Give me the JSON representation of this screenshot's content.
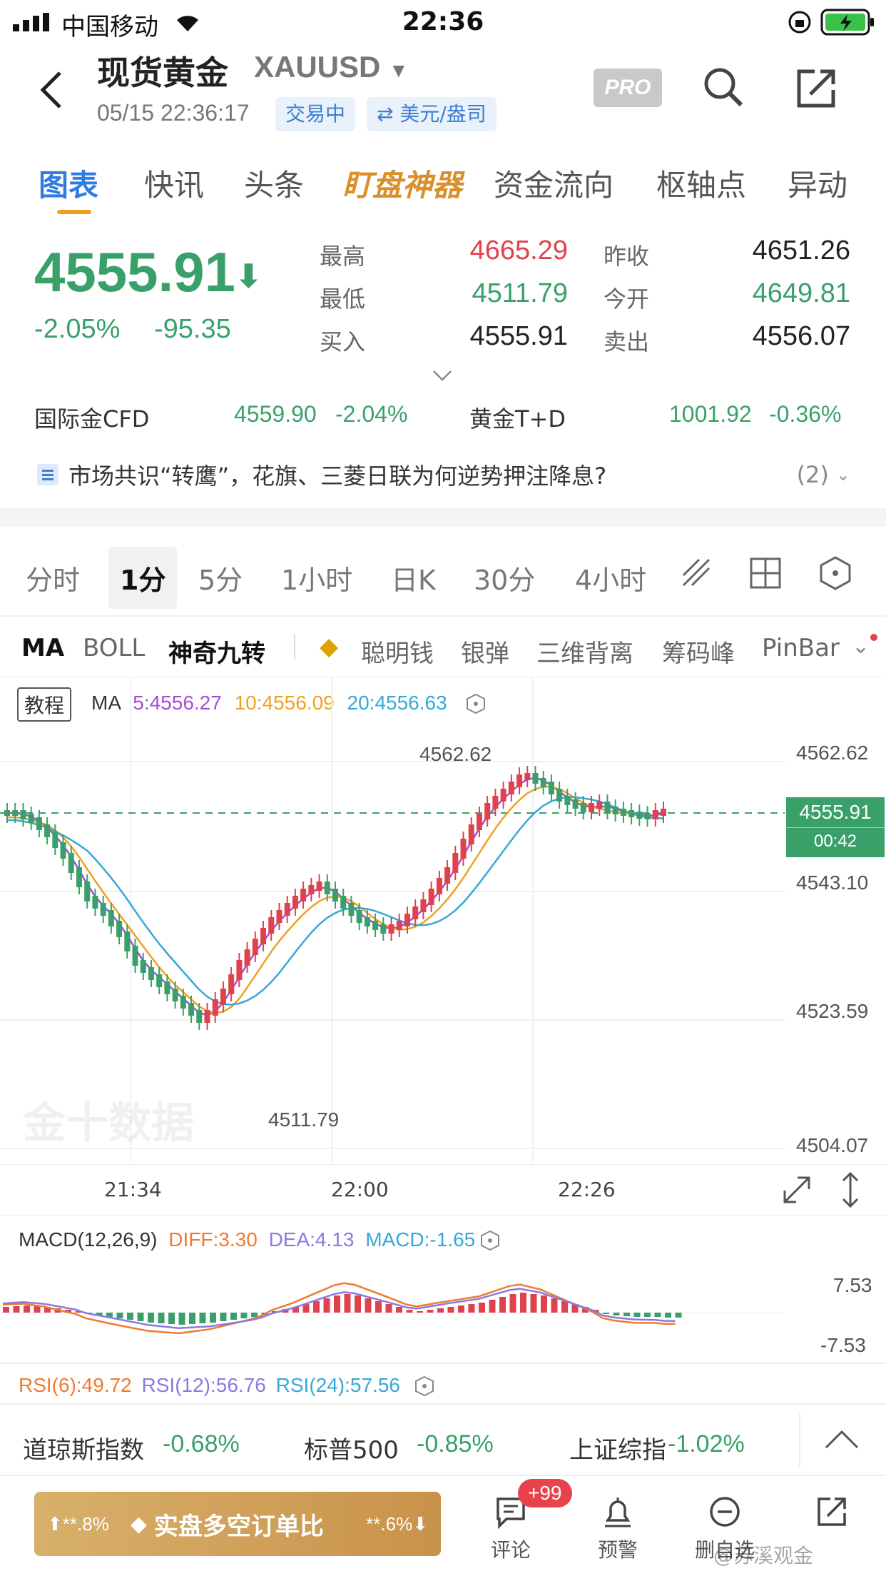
{
  "status_bar": {
    "carrier": "中国移动",
    "time": "22:36"
  },
  "header": {
    "title": "现货黄金",
    "symbol": "XAUUSD",
    "datetime": "05/15 22:36:17",
    "status_pill": "交易中",
    "unit_pill": "⇄ 美元/盎司",
    "pro_badge": "PRO"
  },
  "tabs": [
    "图表",
    "快讯",
    "头条",
    "盯盘神器",
    "资金流向",
    "枢轴点",
    "异动"
  ],
  "quote": {
    "price": "4555.91",
    "change_pct": "-2.05%",
    "change": "-95.35",
    "labels": {
      "high": "最高",
      "low": "最低",
      "bid": "买入",
      "prev_close": "昨收",
      "open": "今开",
      "ask": "卖出"
    },
    "high": "4665.29",
    "low": "4511.79",
    "bid": "4555.91",
    "prev_close": "4651.26",
    "open": "4649.81",
    "ask": "4556.07"
  },
  "related": {
    "cfd_label": "国际金CFD",
    "cfd_price": "4559.90",
    "cfd_pct": "-2.04%",
    "td_label": "黄金T+D",
    "td_price": "1001.92",
    "td_pct": "-0.36%"
  },
  "news": {
    "text": "市场共识“转鹰”，花旗、三菱日联为何逆势押注降息?",
    "count": "(2)"
  },
  "periods": [
    "分时",
    "1分",
    "5分",
    "1小时",
    "日K",
    "30分",
    "4小时"
  ],
  "indicators": [
    "MA",
    "BOLL",
    "神奇九转",
    "聪明钱",
    "银弹",
    "三维背离",
    "筹码峰",
    "PinBar"
  ],
  "chart": {
    "tutorial": "教程",
    "ma_label": "MA",
    "ma5": "5:4556.27",
    "ma10": "10:4556.09",
    "ma20": "20:4556.63",
    "price_labels": [
      "4562.62",
      "4543.10",
      "4523.59",
      "4504.07"
    ],
    "current_price": "4555.91",
    "countdown": "00:42",
    "high_mark": "4562.62",
    "low_mark": "4511.79",
    "time_labels": [
      "21:34",
      "22:00",
      "22:26"
    ],
    "watermark": "金十数据",
    "macd_label": "MACD(12,26,9)",
    "diff": "DIFF:3.30",
    "dea": "DEA:4.13",
    "macd": "MACD:-1.65",
    "macd_scale_top": "7.53",
    "macd_scale_bottom": "-7.53",
    "rsi6": "RSI(6):49.72",
    "rsi12": "RSI(12):56.76",
    "rsi24": "RSI(24):57.56"
  },
  "indices": [
    {
      "name": "道琼斯指数",
      "pct": "-0.68%"
    },
    {
      "name": "标普500",
      "pct": "-0.85%"
    },
    {
      "name": "上证综指",
      "pct": "-1.02%"
    }
  ],
  "bottom": {
    "cta_left": "⬆**.8%",
    "cta_text": "实盘多空订单比",
    "cta_right": "**.6%⬇",
    "comment": "评论",
    "badge": "+99",
    "alert": "预警",
    "remove": "删自选",
    "share_watermark": "@苏溪观金"
  },
  "colors": {
    "up": "#e0424d",
    "down": "#3aa06a",
    "accent": "#2f7de1",
    "ma5": "#a64bd8",
    "ma10": "#f0a020",
    "ma20": "#35a8d8"
  }
}
